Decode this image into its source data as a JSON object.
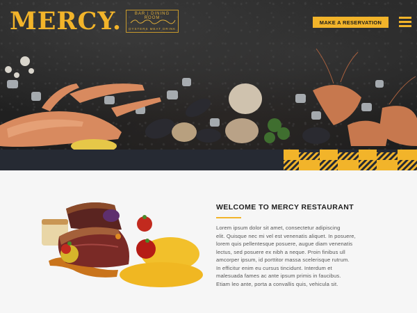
{
  "brand": {
    "name": "MERCY.",
    "tag_top": "BAR | DINING ROOM",
    "tag_bottom": "OYSTERS   MEAT   DRINK"
  },
  "header": {
    "reserve_label": "MAKE A RESERVATION",
    "menu_icon": "hamburger-menu-icon"
  },
  "colors": {
    "accent": "#f2b42a",
    "band": "#262a33",
    "hero_dark": "#1d1d1d",
    "content_bg": "#f6f6f6"
  },
  "welcome": {
    "title": "WELCOME TO MERCY RESTAURANT",
    "lines": [
      "Lorem ipsum dolor sit amet, consectetur adipiscing",
      "elit. Quisque nec mi vel est venenatis aliquet. In posuere,",
      "lorem quis pellentesque posuere, augue diam venenatis",
      "lectus, sed posuere ex nibh a neque. Proin finibus ull",
      "amcorper ipsum, id porttitor massa scelerisque rutrum.",
      "In efficitur enim eu cursus tincidunt. Interdum et",
      "malesuada fames ac ante ipsum primis in faucibus.",
      "Etiam leo ante, porta a convallis quis, vehicula sit."
    ]
  }
}
